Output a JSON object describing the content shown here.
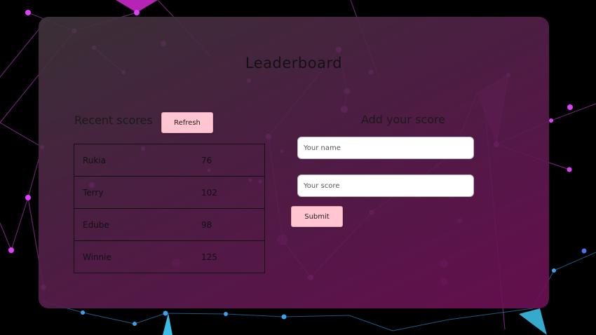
{
  "page": {
    "title": "Leaderboard"
  },
  "scores": {
    "heading": "Recent scores",
    "refresh_label": "Refresh",
    "rows": [
      {
        "name": "Rukia",
        "score": "76"
      },
      {
        "name": "Terry",
        "score": "102"
      },
      {
        "name": "Edube",
        "score": "98"
      },
      {
        "name": "Winnie",
        "score": "125"
      }
    ]
  },
  "form": {
    "heading": "Add your score",
    "name_placeholder": "Your name",
    "name_value": "",
    "score_placeholder": "Your score",
    "score_value": "",
    "submit_label": "Submit"
  },
  "colors": {
    "button_bg": "#ffc5d1",
    "accent_magenta": "#e040fb",
    "accent_cyan": "#29b6f6"
  }
}
